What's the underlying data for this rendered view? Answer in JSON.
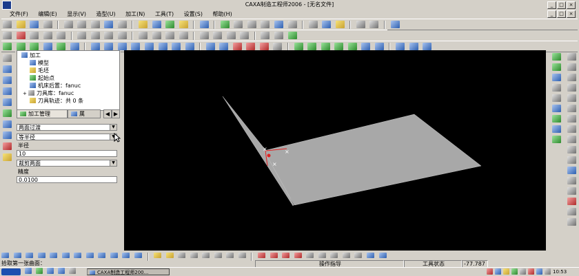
{
  "window": {
    "title": "CAXA制造工程师2006 - [无名文件]"
  },
  "menu": [
    "文件(F)",
    "编辑(E)",
    "显示(V)",
    "造型(U)",
    "加工(N)",
    "工具(T)",
    "设置(S)",
    "帮助(H)"
  ],
  "tree": {
    "root": "加工",
    "items": [
      "模型",
      "毛坯",
      "起始点",
      "机床后置：fanuc",
      "刀具库：fanuc",
      "刀具轨迹：共 0 条"
    ]
  },
  "tabs": [
    "加工管理",
    "属"
  ],
  "form": {
    "surface_mode": "两面过渡",
    "radius_mode": "等半径",
    "radius_label": "半径",
    "radius_value": "10",
    "trim_mode": "裁剪两面",
    "precision_label": "精度",
    "precision_value": "0.0100"
  },
  "status": {
    "prompt": "拾取第一张曲面：",
    "operation_hint": "操作指导",
    "tool_status": "工具状态",
    "coords": "-77.787"
  },
  "taskbar": {
    "app_button": "CAXA制造工程师200...",
    "clock": "10:53"
  },
  "colors": {
    "chrome": "#d4d0c8",
    "canvas": "#000000",
    "surface": "#a8a8a8",
    "accent_red": "#e02020",
    "taskbar_blue": "#1c4fb0"
  }
}
